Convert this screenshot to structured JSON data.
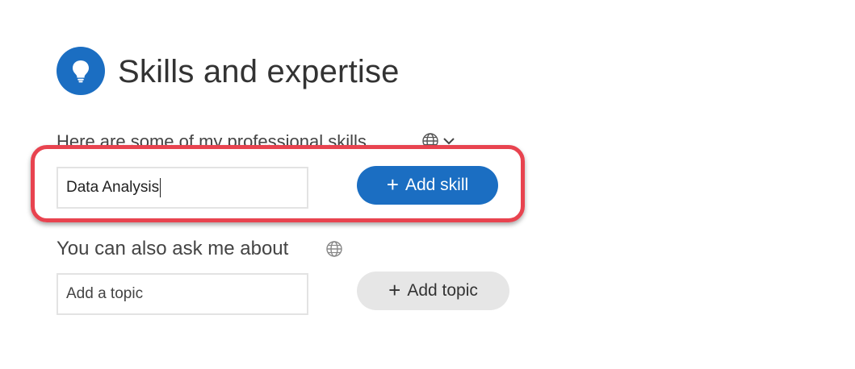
{
  "section": {
    "title": "Skills and expertise",
    "icon": "lightbulb-icon",
    "accent_color": "#1b6ec2"
  },
  "skills": {
    "label": "Here are some of my professional skills",
    "visibility_icon": "globe-icon",
    "dropdown_icon": "chevron-down-icon",
    "input_value": "Data Analysis",
    "add_button_label": "Add skill",
    "highlight_color": "#e8434f"
  },
  "topics": {
    "label": "You can also ask me about",
    "visibility_icon": "globe-icon",
    "input_placeholder": "Add a topic",
    "add_button_label": "Add topic"
  }
}
